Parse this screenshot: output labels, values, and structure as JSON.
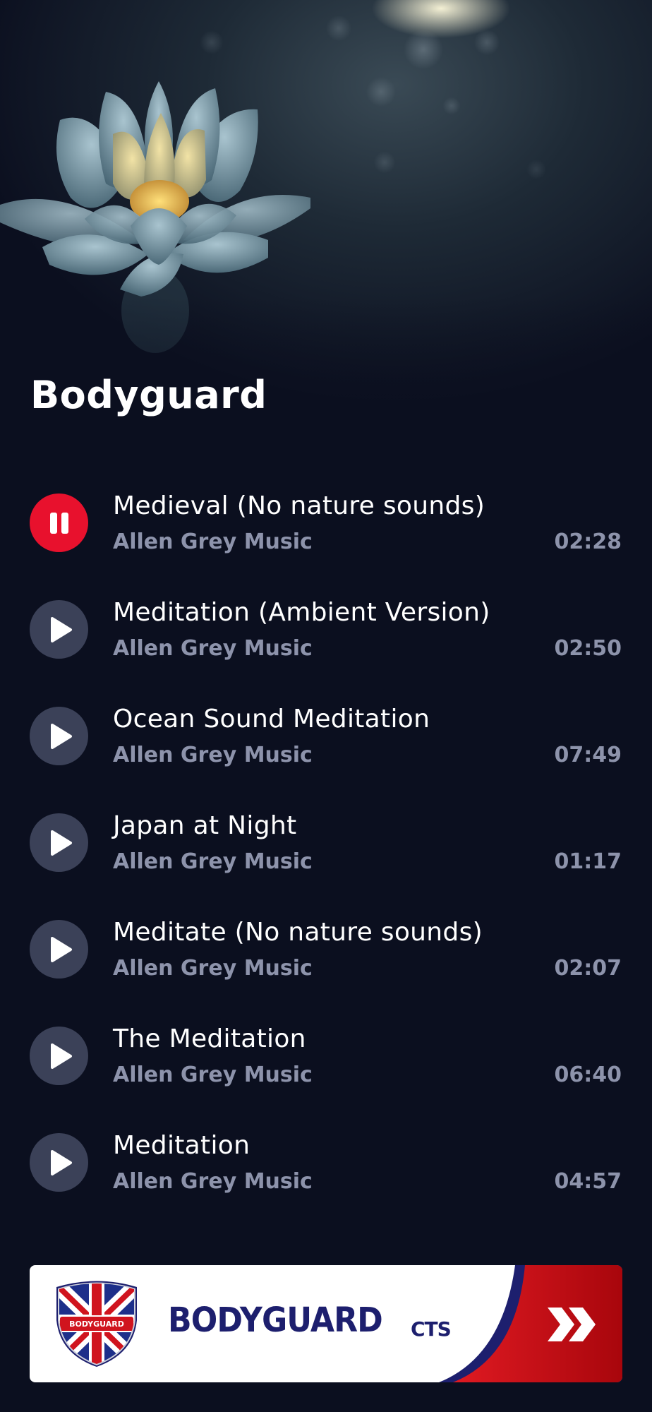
{
  "header": {
    "title": "Bodyguard"
  },
  "tracks": [
    {
      "title": "Medieval (No nature sounds)",
      "artist": "Allen Grey Music",
      "duration": "02:28",
      "state": "playing"
    },
    {
      "title": "Meditation (Ambient Version)",
      "artist": "Allen Grey Music",
      "duration": "02:50",
      "state": "paused"
    },
    {
      "title": "Ocean Sound Meditation",
      "artist": "Allen Grey Music",
      "duration": "07:49",
      "state": "paused"
    },
    {
      "title": "Japan at Night",
      "artist": "Allen Grey Music",
      "duration": "01:17",
      "state": "paused"
    },
    {
      "title": "Meditate (No nature sounds)",
      "artist": "Allen Grey Music",
      "duration": "02:07",
      "state": "paused"
    },
    {
      "title": "The Meditation",
      "artist": "Allen Grey Music",
      "duration": "06:40",
      "state": "paused"
    },
    {
      "title": "Meditation",
      "artist": "Allen Grey Music",
      "duration": "04:57",
      "state": "paused"
    }
  ],
  "banner": {
    "brand": "BODYGUARD",
    "sub_brand": "CTS",
    "shield_text": "BODYGUARD",
    "arrow_icon": "double-chevron-right-icon"
  },
  "colors": {
    "background": "#0b0f1f",
    "active_button": "#e8112d",
    "inactive_button": "#3b4158",
    "secondary_text": "#8d93ab",
    "brand_navy": "#1d1f6e",
    "brand_red": "#c8101a"
  }
}
